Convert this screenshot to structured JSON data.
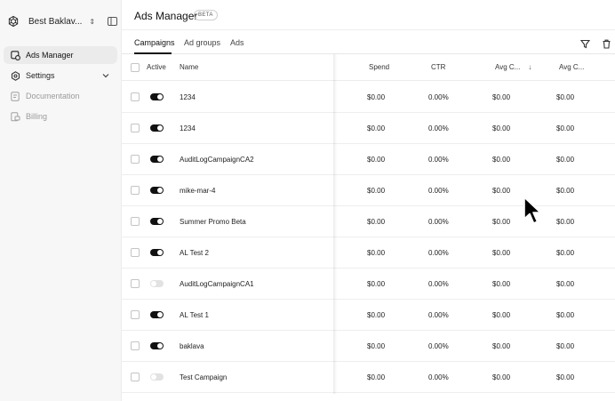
{
  "workspace": {
    "name": "Best Baklav...",
    "switch_icon": "updown-icon",
    "panel_icon": "sidebar-toggle-icon"
  },
  "sidebar": {
    "items": [
      {
        "label": "Ads Manager",
        "icon": "ads-icon",
        "active": true
      },
      {
        "label": "Settings",
        "icon": "gear-icon",
        "expandable": true
      },
      {
        "label": "Documentation",
        "icon": "document-icon",
        "dim": true
      },
      {
        "label": "Billing",
        "icon": "billing-icon",
        "dim": true
      }
    ]
  },
  "header": {
    "title": "Ads Manager",
    "badge": "BETA"
  },
  "tabs": [
    {
      "label": "Campaigns",
      "active": true
    },
    {
      "label": "Ad groups"
    },
    {
      "label": "Ads"
    }
  ],
  "toolbar": {
    "filter_icon": "filter-icon",
    "delete_icon": "trash-icon"
  },
  "table": {
    "columns": [
      "Active",
      "Name",
      "Spend",
      "CTR",
      "Avg C...",
      "Avg C..."
    ],
    "sort_column": "Avg C...",
    "sort_direction": "descending",
    "rows": [
      {
        "active": true,
        "name": "1234",
        "spend": "$0.00",
        "ctr": "0.00%",
        "avg1": "$0.00",
        "avg2": "$0.00"
      },
      {
        "active": true,
        "name": "1234",
        "spend": "$0.00",
        "ctr": "0.00%",
        "avg1": "$0.00",
        "avg2": "$0.00"
      },
      {
        "active": true,
        "name": "AuditLogCampaignCA2",
        "spend": "$0.00",
        "ctr": "0.00%",
        "avg1": "$0.00",
        "avg2": "$0.00"
      },
      {
        "active": true,
        "name": "mike-mar-4",
        "spend": "$0.00",
        "ctr": "0.00%",
        "avg1": "$0.00",
        "avg2": "$0.00"
      },
      {
        "active": true,
        "name": "Summer Promo Beta",
        "spend": "$0.00",
        "ctr": "0.00%",
        "avg1": "$0.00",
        "avg2": "$0.00"
      },
      {
        "active": true,
        "name": "AL Test 2",
        "spend": "$0.00",
        "ctr": "0.00%",
        "avg1": "$0.00",
        "avg2": "$0.00"
      },
      {
        "active": false,
        "name": "AuditLogCampaignCA1",
        "spend": "$0.00",
        "ctr": "0.00%",
        "avg1": "$0.00",
        "avg2": "$0.00"
      },
      {
        "active": true,
        "name": "AL Test 1",
        "spend": "$0.00",
        "ctr": "0.00%",
        "avg1": "$0.00",
        "avg2": "$0.00"
      },
      {
        "active": true,
        "name": "baklava",
        "spend": "$0.00",
        "ctr": "0.00%",
        "avg1": "$0.00",
        "avg2": "$0.00"
      },
      {
        "active": false,
        "name": "Test Campaign",
        "spend": "$0.00",
        "ctr": "0.00%",
        "avg1": "$0.00",
        "avg2": "$0.00"
      }
    ]
  },
  "colors": {
    "accent": "#111111",
    "sidebar_bg": "#f7f7f8",
    "toggle_off": "#e2e2e2"
  }
}
